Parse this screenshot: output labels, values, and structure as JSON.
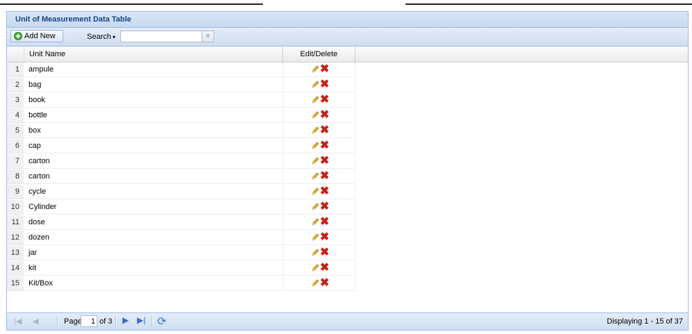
{
  "panel": {
    "title": "Unit of Measurement Data Table"
  },
  "toolbar": {
    "add_label": "Add New",
    "search_label": "Search",
    "search_value": "",
    "clear_label": "×"
  },
  "grid": {
    "columns": {
      "name": "Unit Name",
      "edit_delete": "Edit/Delete"
    },
    "rows": [
      {
        "num": "1",
        "name": "ampule"
      },
      {
        "num": "2",
        "name": "bag"
      },
      {
        "num": "3",
        "name": "book"
      },
      {
        "num": "4",
        "name": "bottle"
      },
      {
        "num": "5",
        "name": "box"
      },
      {
        "num": "6",
        "name": "cap"
      },
      {
        "num": "7",
        "name": "carton"
      },
      {
        "num": "8",
        "name": "carton"
      },
      {
        "num": "9",
        "name": "cycle"
      },
      {
        "num": "10",
        "name": "Cylinder"
      },
      {
        "num": "11",
        "name": "dose"
      },
      {
        "num": "12",
        "name": "dozen"
      },
      {
        "num": "13",
        "name": "jar"
      },
      {
        "num": "14",
        "name": "kit"
      },
      {
        "num": "15",
        "name": "Kit/Box"
      }
    ]
  },
  "pager": {
    "page_label": "Page",
    "page_value": "1",
    "of_label": "of 3",
    "display_text": "Displaying 1 - 15 of 37"
  },
  "colors": {
    "accent": "#15428b",
    "border": "#99bbe8",
    "delete": "#c8201a",
    "edit": "#e8b830",
    "add": "#4caf37"
  },
  "icons": [
    "add-icon",
    "chevron-down-icon",
    "clear-icon",
    "pencil-icon",
    "delete-icon",
    "first-page-icon",
    "prev-page-icon",
    "next-page-icon",
    "last-page-icon",
    "refresh-icon"
  ]
}
